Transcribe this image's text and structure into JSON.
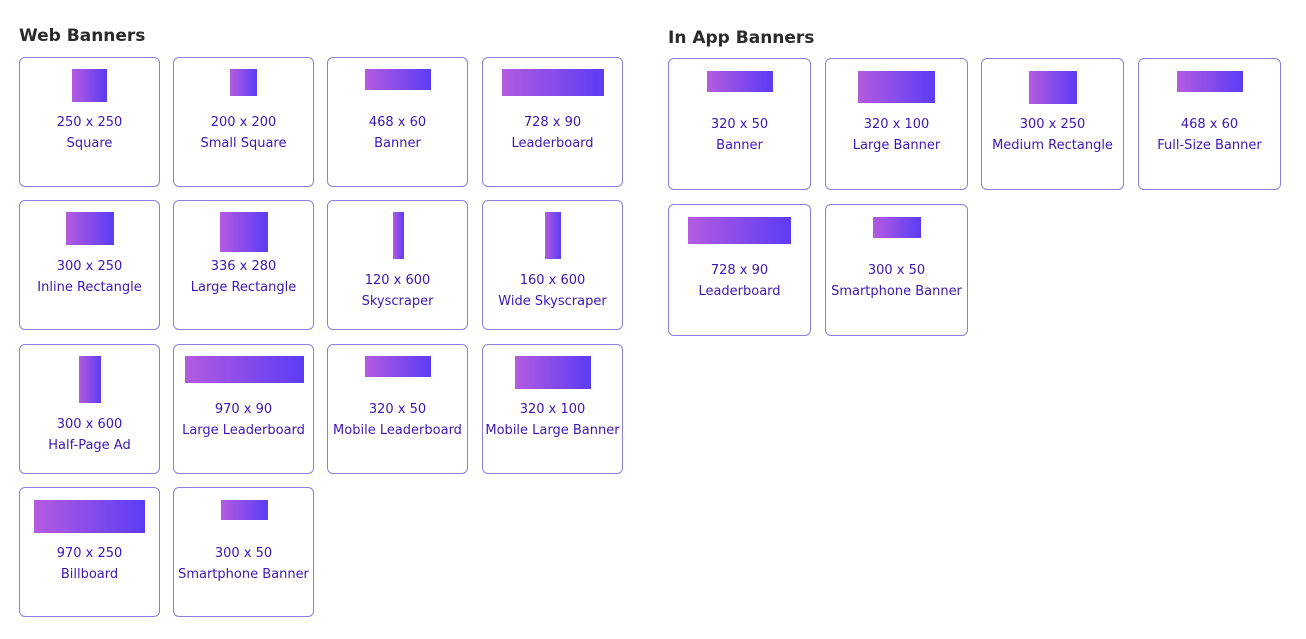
{
  "web": {
    "title": "Web Banners",
    "cards": [
      {
        "dims": "250 x 250",
        "label": "Square"
      },
      {
        "dims": "200 x 200",
        "label": "Small Square"
      },
      {
        "dims": "468 x 60",
        "label": "Banner"
      },
      {
        "dims": "728 x 90",
        "label": "Leaderboard"
      },
      {
        "dims": "300 x 250",
        "label": "Inline Rectangle"
      },
      {
        "dims": "336 x 280",
        "label": "Large Rectangle"
      },
      {
        "dims": "120 x 600",
        "label": "Skyscraper"
      },
      {
        "dims": "160 x 600",
        "label": "Wide Skyscraper"
      },
      {
        "dims": "300 x 600",
        "label": "Half-Page Ad"
      },
      {
        "dims": "970 x 90",
        "label": "Large Leaderboard"
      },
      {
        "dims": "320 x 50",
        "label": "Mobile Leaderboard"
      },
      {
        "dims": "320 x 100",
        "label": "Mobile Large Banner"
      },
      {
        "dims": "970 x 250",
        "label": "Billboard"
      },
      {
        "dims": "300 x 50",
        "label": "Smartphone Banner"
      }
    ]
  },
  "inapp": {
    "title": "In App Banners",
    "cards": [
      {
        "dims": "320 x 50",
        "label": "Banner"
      },
      {
        "dims": "320 x 100",
        "label": "Large Banner"
      },
      {
        "dims": "300 x 250",
        "label": "Medium Rectangle"
      },
      {
        "dims": "468 x 60",
        "label": "Full-Size Banner"
      },
      {
        "dims": "728 x 90",
        "label": "Leaderboard"
      },
      {
        "dims": "300 x 50",
        "label": "Smartphone Banner"
      }
    ]
  },
  "colors": {
    "border": "#8a7fe0",
    "text": "#3d17b5",
    "gradient_start": "#b45be0",
    "gradient_end": "#5b3cf5"
  }
}
